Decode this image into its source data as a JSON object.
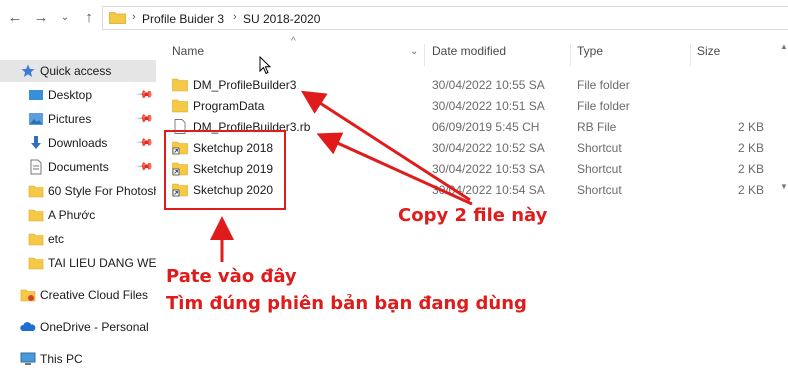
{
  "address": {
    "crumbs": [
      "Profile Buider 3",
      "SU 2018-2020"
    ]
  },
  "sidebar": {
    "items": [
      {
        "label": "Quick access",
        "icon": "star-icon",
        "pinned": false
      },
      {
        "label": "Desktop",
        "icon": "desktop-icon",
        "pinned": true
      },
      {
        "label": "Pictures",
        "icon": "pictures-icon",
        "pinned": true
      },
      {
        "label": "Downloads",
        "icon": "download-icon",
        "pinned": true
      },
      {
        "label": "Documents",
        "icon": "documents-icon",
        "pinned": true
      },
      {
        "label": "60 Style For Photosh",
        "icon": "folder-icon",
        "pinned": false
      },
      {
        "label": "A Phước",
        "icon": "folder-icon",
        "pinned": false
      },
      {
        "label": "etc",
        "icon": "folder-icon",
        "pinned": false
      },
      {
        "label": "TAI LIEU DANG WEE",
        "icon": "folder-icon",
        "pinned": false
      },
      {
        "label": "Creative Cloud Files",
        "icon": "creative-cloud-icon",
        "pinned": false
      },
      {
        "label": "OneDrive - Personal",
        "icon": "onedrive-icon",
        "pinned": false
      },
      {
        "label": "This PC",
        "icon": "computer-icon",
        "pinned": false
      }
    ]
  },
  "columns": {
    "name": "Name",
    "date": "Date modified",
    "type": "Type",
    "size": "Size"
  },
  "files": [
    {
      "name": "DM_ProfileBuilder3",
      "date": "30/04/2022 10:55 SA",
      "type": "File folder",
      "size": "",
      "icon": "folder-icon"
    },
    {
      "name": "ProgramData",
      "date": "30/04/2022 10:51 SA",
      "type": "File folder",
      "size": "",
      "icon": "folder-icon"
    },
    {
      "name": "DM_ProfileBuilder3.rb",
      "date": "06/09/2019 5:45 CH",
      "type": "RB File",
      "size": "2 KB",
      "icon": "file-icon"
    },
    {
      "name": "Sketchup 2018",
      "date": "30/04/2022 10:52 SA",
      "type": "Shortcut",
      "size": "2 KB",
      "icon": "shortcut-icon"
    },
    {
      "name": "Sketchup 2019",
      "date": "30/04/2022 10:53 SA",
      "type": "Shortcut",
      "size": "2 KB",
      "icon": "shortcut-icon"
    },
    {
      "name": "Sketchup 2020",
      "date": "30/04/2022 10:54 SA",
      "type": "Shortcut",
      "size": "2 KB",
      "icon": "shortcut-icon"
    }
  ],
  "annotations": {
    "copy": "Copy 2 file này",
    "paste_line1": "Pate vào đây",
    "paste_line2": "Tìm đúng phiên bản bạn đang dùng",
    "color": "#e01b1b"
  }
}
